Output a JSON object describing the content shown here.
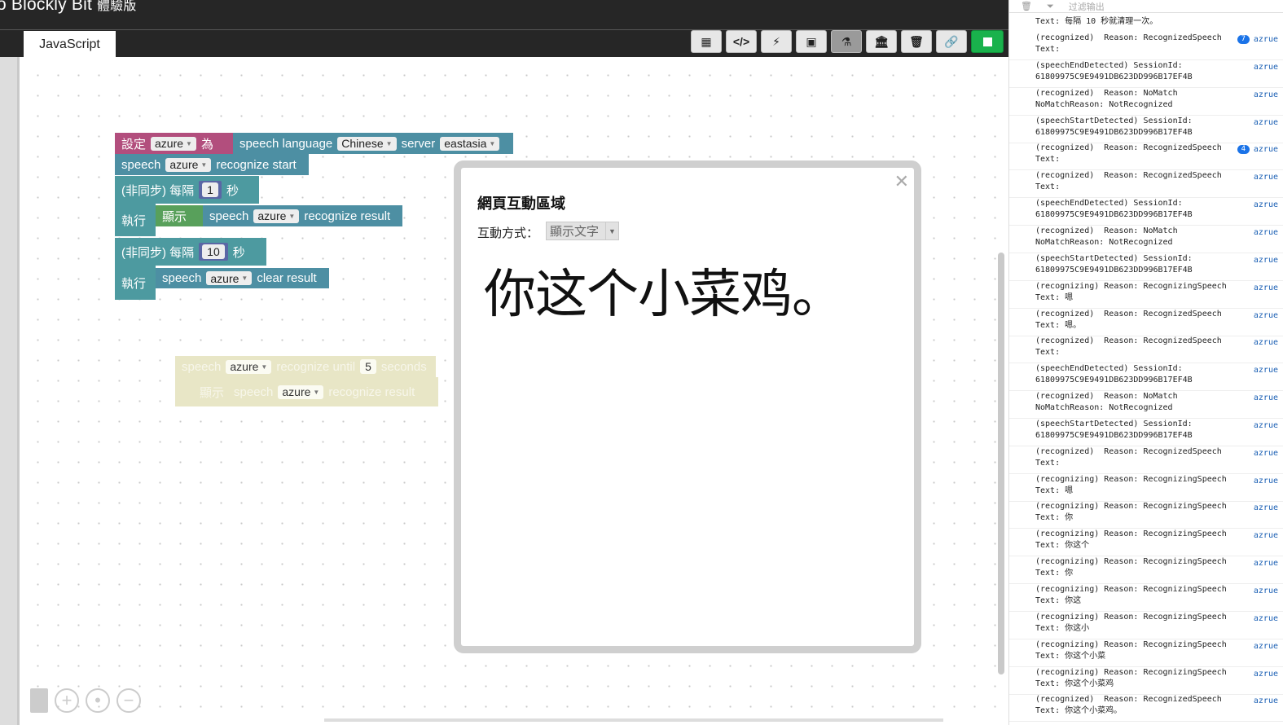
{
  "app": {
    "title": "o Blockly Bit",
    "subtitle": "體驗版"
  },
  "tabs": {
    "active": "JavaScript"
  },
  "blocks": {
    "set_label": "設定",
    "var_name": "azure",
    "as_label": "為",
    "speech_language": "speech language",
    "language": "Chinese",
    "server_label": "server",
    "server": "eastasia",
    "speech": "speech",
    "recognize_start": "recognize start",
    "async_every": "(非同步) 每隔",
    "interval1": "1",
    "sec": "秒",
    "execute": "執行",
    "show": "顯示",
    "recognize_result": "recognize result",
    "interval2": "10",
    "clear_result": "clear result",
    "ghost_recognize_until": "recognize until",
    "ghost_seconds_value": "5",
    "ghost_seconds": "seconds"
  },
  "dialog": {
    "title": "網頁互動區域",
    "mode_label": "互動方式：",
    "mode_value": "顯示文字",
    "result_text": "你这个小菜鸡。"
  },
  "console": {
    "filter_placeholder": "过滤输出",
    "entries": [
      {
        "l1": "Text: 每隔 10 秒就清理一次。",
        "l2": "",
        "badge": ""
      },
      {
        "l1": "(recognized)  Reason: RecognizedSpeech",
        "l2": "Text:",
        "badge": "7"
      },
      {
        "l1": "(speechEndDetected) SessionId:",
        "l2": "61809975C9E9491DB623DD996B17EF4B",
        "badge": ""
      },
      {
        "l1": "(recognized)  Reason: NoMatch",
        "l2": "NoMatchReason: NotRecognized",
        "badge": ""
      },
      {
        "l1": "(speechStartDetected) SessionId:",
        "l2": "61809975C9E9491DB623DD996B17EF4B",
        "badge": ""
      },
      {
        "l1": "(recognized)  Reason: RecognizedSpeech",
        "l2": "Text:",
        "badge": "4"
      },
      {
        "l1": "(recognized)  Reason: RecognizedSpeech",
        "l2": "Text:",
        "badge": ""
      },
      {
        "l1": "(speechEndDetected) SessionId:",
        "l2": "61809975C9E9491DB623DD996B17EF4B",
        "badge": ""
      },
      {
        "l1": "(recognized)  Reason: NoMatch",
        "l2": "NoMatchReason: NotRecognized",
        "badge": ""
      },
      {
        "l1": "(speechStartDetected) SessionId:",
        "l2": "61809975C9E9491DB623DD996B17EF4B",
        "badge": ""
      },
      {
        "l1": "(recognizing) Reason: RecognizingSpeech",
        "l2": "Text: 嗯",
        "badge": ""
      },
      {
        "l1": "(recognized)  Reason: RecognizedSpeech",
        "l2": "Text: 嗯。",
        "badge": ""
      },
      {
        "l1": "(recognized)  Reason: RecognizedSpeech",
        "l2": "Text:",
        "badge": ""
      },
      {
        "l1": "(speechEndDetected) SessionId:",
        "l2": "61809975C9E9491DB623DD996B17EF4B",
        "badge": ""
      },
      {
        "l1": "(recognized)  Reason: NoMatch",
        "l2": "NoMatchReason: NotRecognized",
        "badge": ""
      },
      {
        "l1": "(speechStartDetected) SessionId:",
        "l2": "61809975C9E9491DB623DD996B17EF4B",
        "badge": ""
      },
      {
        "l1": "(recognized)  Reason: RecognizedSpeech",
        "l2": "Text:",
        "badge": ""
      },
      {
        "l1": "(recognizing) Reason: RecognizingSpeech",
        "l2": "Text: 嗯",
        "badge": ""
      },
      {
        "l1": "(recognizing) Reason: RecognizingSpeech",
        "l2": "Text: 你",
        "badge": ""
      },
      {
        "l1": "(recognizing) Reason: RecognizingSpeech",
        "l2": "Text: 你这个",
        "badge": ""
      },
      {
        "l1": "(recognizing) Reason: RecognizingSpeech",
        "l2": "Text: 你",
        "badge": ""
      },
      {
        "l1": "(recognizing) Reason: RecognizingSpeech",
        "l2": "Text: 你这",
        "badge": ""
      },
      {
        "l1": "(recognizing) Reason: RecognizingSpeech",
        "l2": "Text: 你这小",
        "badge": ""
      },
      {
        "l1": "(recognizing) Reason: RecognizingSpeech",
        "l2": "Text: 你这个小菜",
        "badge": ""
      },
      {
        "l1": "(recognizing) Reason: RecognizingSpeech",
        "l2": "Text: 你这个小菜鸡",
        "badge": ""
      },
      {
        "l1": "(recognized)  Reason: RecognizedSpeech",
        "l2": "Text: 你这个小菜鸡。",
        "badge": ""
      }
    ],
    "source_label": "azrue"
  },
  "colors": {
    "accent_green": "#19b24c",
    "block_pink": "#b24e7d",
    "block_teal": "#4d8fa3"
  }
}
